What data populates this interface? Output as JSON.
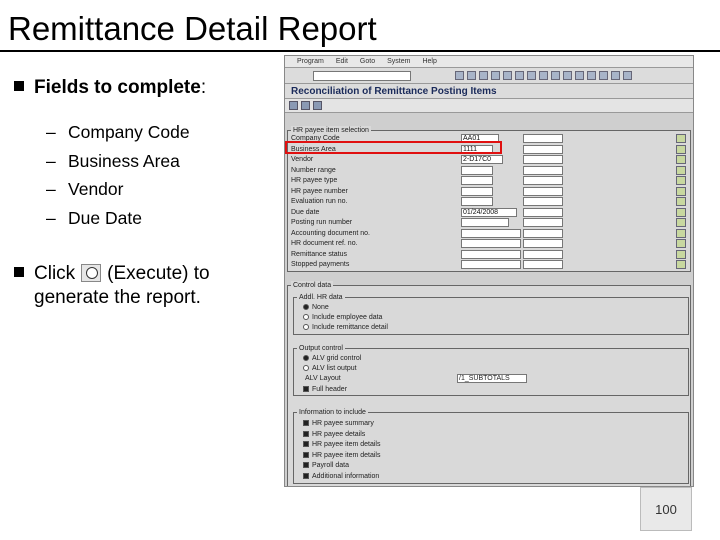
{
  "slide": {
    "title": "Remittance Detail Report",
    "bullet1_bold": "Fields to complete",
    "bullet1_colon": ":",
    "fields": [
      "Company Code",
      "Business Area",
      "Vendor",
      "Due Date"
    ],
    "dash": "–",
    "bullet2_click": "Click",
    "bullet2_execute": "(Execute)",
    "bullet2_to": "to",
    "bullet2_line2": "generate the report.",
    "page_number": "100"
  },
  "sap": {
    "menu": [
      "Program",
      "Edit",
      "Goto",
      "System",
      "Help"
    ],
    "title": "Reconciliation of Remittance Posting Items",
    "selection_frame": "HR payee item selection",
    "selection_rows": [
      {
        "label": "Company Code",
        "value": "AA01"
      },
      {
        "label": "Business Area",
        "value": "1111"
      },
      {
        "label": "Vendor",
        "value": "2-D17C0"
      },
      {
        "label": "Number range",
        "value": ""
      },
      {
        "label": "HR payee type",
        "value": ""
      },
      {
        "label": "HR payee number",
        "value": ""
      },
      {
        "label": "Evaluation run no.",
        "value": ""
      },
      {
        "label": "Due date",
        "value": "01/24/2008"
      },
      {
        "label": "Posting run number",
        "value": ""
      },
      {
        "label": "Accounting document no.",
        "value": ""
      },
      {
        "label": "HR document ref. no.",
        "value": ""
      },
      {
        "label": "Remittance status",
        "value": ""
      },
      {
        "label": "Stopped payments",
        "value": ""
      }
    ],
    "control_frame": "Control data",
    "addl_frame": "Addl. HR data",
    "addl_options": [
      "None",
      "Include employee data",
      "Include remittance detail"
    ],
    "output_frame": "Output control",
    "output_options": [
      "ALV grid control",
      "ALV list output"
    ],
    "alv_layout_label": "ALV Layout",
    "alv_layout_value": "/1_SUBTOTALS",
    "full_header": "Full header",
    "info_frame": "Information to include",
    "info_options": [
      "HR payee summary",
      "HR payee details",
      "HR payee item details",
      "HR payee item details",
      "Payroll data",
      "Additional information"
    ]
  }
}
